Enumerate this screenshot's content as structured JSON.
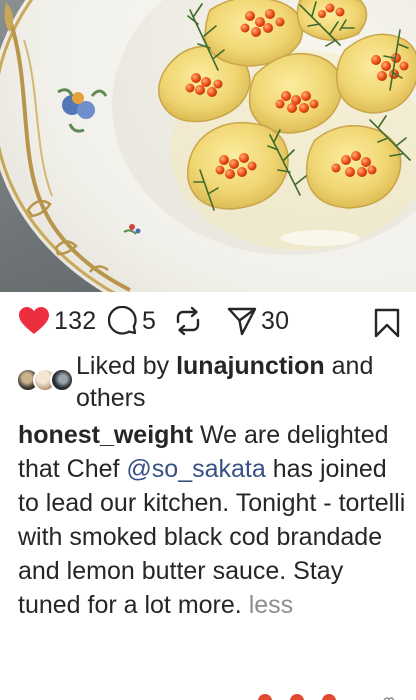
{
  "post": {
    "likes": "132",
    "comments": "5",
    "shares": "30"
  },
  "liked_by": {
    "prefix": "Liked by",
    "user": "lunajunction",
    "suffix": "and others"
  },
  "caption": {
    "username": "honest_weight",
    "text_before": "We are delighted that Chef",
    "mention": "@so_sakata",
    "text_after": "has joined to lead our kitchen. Tonight - tortelli with smoked black cod brandade and lemon butter sauce. Stay tuned for a lot more.",
    "less_label": "less"
  },
  "icons": {
    "like": "heart-icon",
    "comment": "comment-bubble-icon",
    "repost": "repost-icon",
    "share": "send-icon",
    "save": "bookmark-icon"
  },
  "colors": {
    "like": "#ed2e41",
    "mention": "#385185",
    "muted": "#8e8e8e",
    "text": "#262626"
  }
}
